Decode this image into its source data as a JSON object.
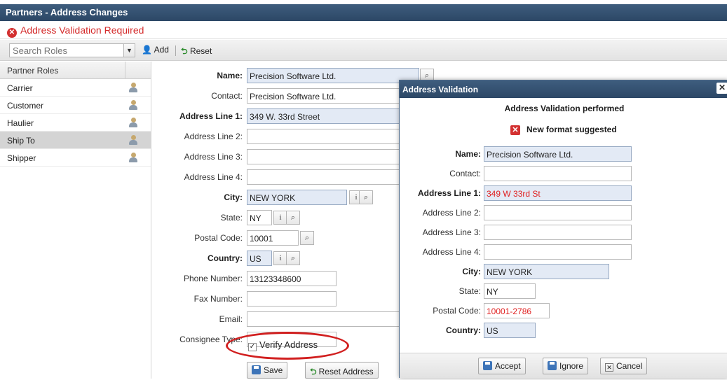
{
  "window": {
    "title": "Partners - Address Changes"
  },
  "alert": {
    "icon": "error-circle-icon",
    "text": "Address Validation Required"
  },
  "toolbar": {
    "search_placeholder": "Search Roles",
    "add_label": "Add",
    "reset_label": "Reset"
  },
  "roles": {
    "header": "Partner Roles",
    "items": [
      {
        "label": "Carrier",
        "selected": false
      },
      {
        "label": "Customer",
        "selected": false
      },
      {
        "label": "Haulier",
        "selected": false
      },
      {
        "label": "Ship To",
        "selected": true
      },
      {
        "label": "Shipper",
        "selected": false
      }
    ]
  },
  "form": {
    "name_label": "Name:",
    "name_value": "Precision Software Ltd.",
    "contact_label": "Contact:",
    "contact_value": "Precision Software Ltd.",
    "address1_label": "Address Line 1:",
    "address1_value": "349 W. 33rd Street",
    "address2_label": "Address Line 2:",
    "address2_value": "",
    "address3_label": "Address Line 3:",
    "address3_value": "",
    "address4_label": "Address Line 4:",
    "address4_value": "",
    "city_label": "City:",
    "city_value": "NEW YORK",
    "state_label": "State:",
    "state_value": "NY",
    "postal_label": "Postal Code:",
    "postal_value": "10001",
    "country_label": "Country:",
    "country_value": "US",
    "phone_label": "Phone Number:",
    "phone_value": "13123348600",
    "fax_label": "Fax Number:",
    "fax_value": "",
    "email_label": "Email:",
    "email_value": "",
    "consignee_label": "Consignee Type:",
    "consignee_value": "",
    "verify_label": "Verify Address",
    "verify_checked": true,
    "save_label": "Save",
    "reset_address_label": "Reset Address"
  },
  "dialog": {
    "title": "Address Validation",
    "heading": "Address Validation performed",
    "warning": "New format suggested",
    "name_label": "Name:",
    "name_value": "Precision Software Ltd.",
    "contact_label": "Contact:",
    "contact_value": "",
    "address1_label": "Address Line 1:",
    "address1_value": "349 W 33rd St",
    "address2_label": "Address Line 2:",
    "address2_value": "",
    "address3_label": "Address Line 3:",
    "address3_value": "",
    "address4_label": "Address Line 4:",
    "address4_value": "",
    "city_label": "City:",
    "city_value": "NEW YORK",
    "state_label": "State:",
    "state_value": "NY",
    "postal_label": "Postal Code:",
    "postal_value": "10001-2786",
    "country_label": "Country:",
    "country_value": "US",
    "accept_label": "Accept",
    "ignore_label": "Ignore",
    "cancel_label": "Cancel"
  },
  "colors": {
    "title_bar": "#34506f",
    "alert_text": "#d42a2a",
    "required_field": "#e3eaf5",
    "suggested_text": "#e02020",
    "highlight_oval": "#d11f1f"
  }
}
